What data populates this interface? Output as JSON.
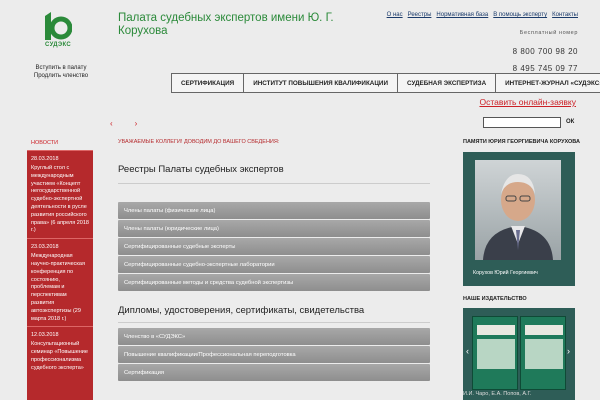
{
  "header": {
    "logo_text": "СУДЭКС",
    "login_link": "Вступить в палату",
    "extend_link": "Продлить членство",
    "site_title": "Палата судебных экспертов имени Ю. Г. Корухова",
    "top_links": [
      "О нас",
      "Реестры",
      "Нормативная база",
      "В помощь эксперту",
      "Контакты"
    ],
    "free_label": "Бесплатный номер",
    "phone_free": "8 800 700 98 20",
    "phone_paid": "8 495 745 09 77"
  },
  "nav": {
    "items": [
      "СЕРТИФИКАЦИЯ",
      "ИНСТИТУТ ПОВЫШЕНИЯ КВАЛИФИКАЦИИ",
      "СУДЕБНАЯ ЭКСПЕРТИЗА",
      "ИНТЕРНЕТ-ЖУРНАЛ «СУДЭКС»"
    ],
    "request_link": "Оставить онлайн-заявку"
  },
  "search": {
    "button": "ОК",
    "placeholder": ""
  },
  "slider": {
    "prev": "‹",
    "next": "›"
  },
  "news": {
    "heading": "НОВОСТИ",
    "items": [
      {
        "date": "28.03.2018",
        "text": "Круглый стол с международным участием «Концепт негосударственной судебно-экспертной деятельности в русле развития российского права» (6 апреля 2018 г.)"
      },
      {
        "date": "23.03.2018",
        "text": "Международная научно-практическая конференция по состоянию, проблемам и перспективам развития автоэкспертизы (29 марта 2018 г.)"
      },
      {
        "date": "12.03.2018",
        "text": "Консультационный семинар «Повышение профессионализма судебного эксперта»"
      }
    ]
  },
  "main": {
    "notice": "УВАЖАЕМЫЕ КОЛЛЕГИ! ДОВОДИМ ДО ВАШЕГО СВЕДЕНИЯ:",
    "registries_title": "Реестры Палаты судебных экспертов",
    "registries": [
      "Члены палаты (физические лица)",
      "Члены палаты (юридические лица)",
      "Сертифицированные судебные эксперты",
      "Сертифицированные судебно-экспертные лаборатории",
      "Сертифицированные методы и средства судебной экспертизы"
    ],
    "diplomas_title": "Дипломы, удостоверения, сертификаты, свидетельства",
    "diplomas": [
      "Членство в «СУДЭКС»",
      "Повышение квалификации/Профессиональная переподготовка",
      "Сертификация"
    ]
  },
  "sidebar": {
    "memory_title": "ПАМЯТИ ЮРИЯ ГЕОРГИЕВИЧА КОРУХОВА",
    "memory_name": "Корухов Юрий Георгиевич",
    "publishing_title": "НАШЕ ИЗДАТЕЛЬСТВО",
    "publishing_author": "И.И. Чаро, Е.А. Попов, А.Г.",
    "pub_prev": "‹",
    "pub_next": "›"
  },
  "colors": {
    "accent_green": "#2b8a3a",
    "accent_red": "#cc2026",
    "news_bg": "#b5292c",
    "panel_teal": "#2e5d57"
  }
}
